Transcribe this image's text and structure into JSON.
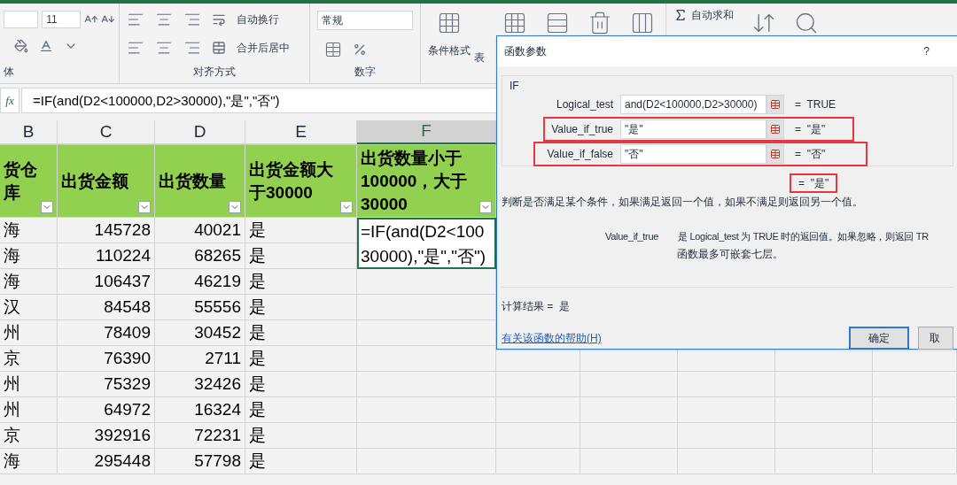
{
  "ribbon": {
    "font_size": "11",
    "wrap_text": "自动换行",
    "merge_center": "合并后居中",
    "number_format": "常规",
    "conditional_format": "条件格式",
    "table_format": "表",
    "autosum": "自动求和",
    "groups": [
      "体",
      "对齐方式",
      "数字"
    ]
  },
  "formula_bar": {
    "fx": "fx",
    "formula": "=IF(and(D2<100000,D2>30000),\"是\",\"否\")"
  },
  "sheet": {
    "columns": [
      {
        "label": "B",
        "selected": false
      },
      {
        "label": "C",
        "selected": false
      },
      {
        "label": "D",
        "selected": false
      },
      {
        "label": "E",
        "selected": false
      },
      {
        "label": "F",
        "selected": true
      }
    ],
    "header_row": [
      "货仓库",
      "出货金额",
      "出货数量",
      "出货金额大于30000",
      "出货数量小于100000，大于30000"
    ],
    "rows": [
      [
        "海",
        "145728",
        "40021",
        "是"
      ],
      [
        "海",
        "110224",
        "68265",
        "是"
      ],
      [
        "海",
        "106437",
        "46219",
        "是"
      ],
      [
        "汉",
        "84548",
        "55556",
        "是"
      ],
      [
        "州",
        "78409",
        "30452",
        "是"
      ],
      [
        "京",
        "76390",
        "2711",
        "是"
      ],
      [
        "州",
        "75329",
        "32426",
        "是"
      ],
      [
        "州",
        "64972",
        "16324",
        "是"
      ],
      [
        "京",
        "392916",
        "72231",
        "是"
      ],
      [
        "海",
        "295448",
        "57798",
        "是"
      ]
    ],
    "editing_cell": {
      "lines": [
        "=IF(and(D2<100",
        "30000),\"是\",\"否\")"
      ]
    }
  },
  "dialog": {
    "title": "函数参数",
    "help": "?",
    "function": "IF",
    "args": [
      {
        "label": "Logical_test",
        "value": "and(D2<100000,D2>30000)",
        "result": "=  TRUE",
        "highlighted": false
      },
      {
        "label": "Value_if_true",
        "value": "\"是\"",
        "result": "=  \"是\"",
        "highlighted": true
      },
      {
        "label": "Value_if_false",
        "value": "\"否\"",
        "result": "=  \"否\"",
        "highlighted": true
      }
    ],
    "overall": {
      "text": "=  \"是\"",
      "highlighted": true
    },
    "description": "判断是否满足某个条件，如果满足返回一个值，如果不满足则返回另一个值。",
    "detail_name": "Value_if_true",
    "detail_text": "是 Logical_test 为 TRUE 时的返回值。如果忽略，则返回 TR",
    "detail_line2": "函数最多可嵌套七层。",
    "calc_label": "计算结果 =",
    "calc_value": "是",
    "help_link": "有关该函数的帮助(H)",
    "ok": "确定",
    "cancel": "取"
  }
}
